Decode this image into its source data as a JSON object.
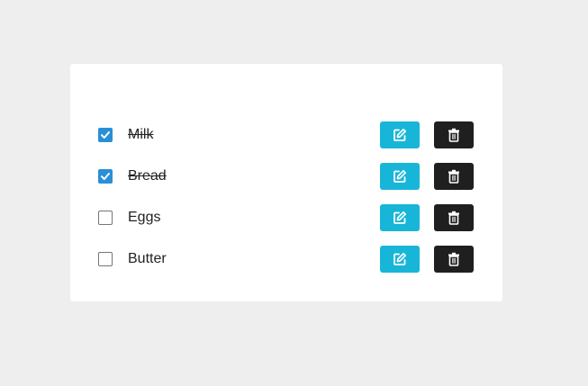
{
  "todo": {
    "items": [
      {
        "label": "Milk",
        "checked": true
      },
      {
        "label": "Bread",
        "checked": true
      },
      {
        "label": "Eggs",
        "checked": false
      },
      {
        "label": "Butter",
        "checked": false
      }
    ],
    "edit_icon": "edit-icon",
    "delete_icon": "trash-icon"
  },
  "colors": {
    "background": "#eeeeee",
    "card": "#ffffff",
    "checkbox_checked": "#2a8fd6",
    "edit_button": "#17b6d8",
    "delete_button": "#1f1f1f"
  }
}
